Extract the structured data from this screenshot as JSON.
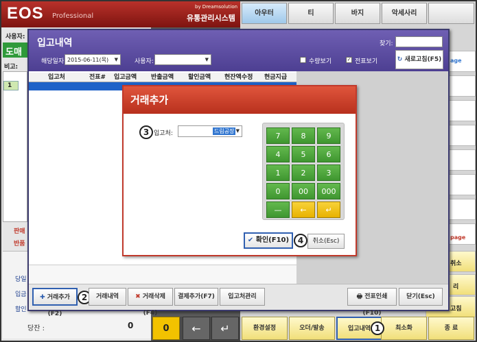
{
  "brand": {
    "name": "EOS",
    "edition": "Professional",
    "by": "by Dreamsolution",
    "system": "유통관리시스템"
  },
  "left": {
    "user_label": "사용자:",
    "mode": "도매",
    "note_label": "비고:",
    "row_num": "1",
    "red1": "판매",
    "red2": "반품",
    "stats": [
      "당일",
      "입금",
      "할인"
    ],
    "balance_label": "당잔 :",
    "balance_value": "0"
  },
  "categories": [
    "아우터",
    "티",
    "바지",
    "악세사리"
  ],
  "side": {
    "page1": "age",
    "page2": "page",
    "cancel": "취소",
    "ri": "리",
    "close_jo": "고침"
  },
  "keypad_bottom": {
    "zero": "0",
    "back": "←",
    "enter": "↵"
  },
  "bottom_buttons": [
    "환경설정",
    "오더/발송",
    "입고내역",
    "최소화",
    "종 료"
  ],
  "history": {
    "title": "입고내역",
    "search_label": "찾기:",
    "search_value": "",
    "date_label": "해당일자:",
    "date_value": "2015-06-11(목)",
    "user_label": "사용자:",
    "user_value": "",
    "chk_qty": "수량보기",
    "chk_voucher": "전표보기",
    "refresh": "새로고침(F5)",
    "columns": [
      "입고처",
      "전표#",
      "입고금액",
      "반출금액",
      "할인금액",
      "현잔액수정",
      "현금지급"
    ],
    "footer": {
      "add": "거래추가(F2)",
      "history": "거래내역",
      "delete": "거래삭제(F4)",
      "pay": "결제추가(F7)",
      "vendor": "입고처관리",
      "print": "전표인쇄(F10)",
      "close": "닫기(Esc)"
    }
  },
  "add_dialog": {
    "title": "거래추가",
    "vendor_label": "입고처:",
    "vendor_value": "드림공장",
    "keys": [
      "7",
      "8",
      "9",
      "4",
      "5",
      "6",
      "1",
      "2",
      "3",
      "0",
      "00",
      "000",
      "—",
      "←",
      "↵"
    ],
    "ok": "확인(F10)",
    "cancel": "취소(Esc)"
  },
  "callouts": [
    "1",
    "2",
    "3",
    "4"
  ],
  "colors": {
    "purple": "#4d3f92",
    "red": "#c0392b",
    "green": "#3f9630",
    "yellow": "#f2c200",
    "highlight": "#2f5fb0"
  }
}
